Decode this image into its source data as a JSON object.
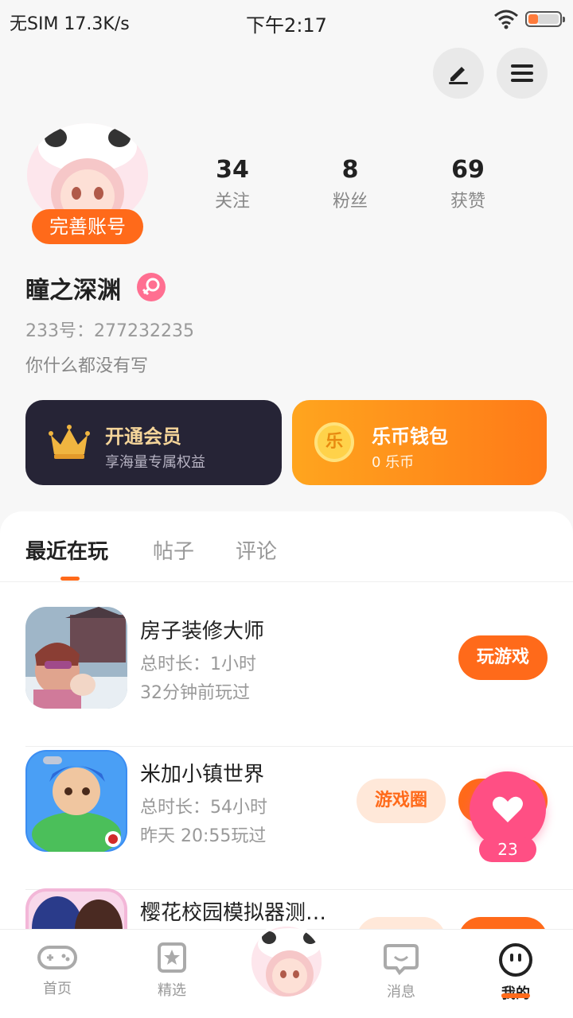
{
  "status_bar": {
    "carrier_speed": "无SIM 17.3K/s",
    "time": "下午2:17"
  },
  "profile": {
    "complete_label": "完善账号",
    "stats": [
      {
        "value": "34",
        "label": "关注"
      },
      {
        "value": "8",
        "label": "粉丝"
      },
      {
        "value": "69",
        "label": "获赞"
      }
    ],
    "username": "瞳之深渊",
    "uid": "233号：277232235",
    "bio": "你什么都没有写"
  },
  "cards": {
    "vip": {
      "title": "开通会员",
      "subtitle": "享海量专属权益"
    },
    "wallet": {
      "title": "乐币钱包",
      "subtitle": "0 乐币",
      "coin_char": "乐"
    }
  },
  "tabs": [
    {
      "label": "最近在玩"
    },
    {
      "label": "帖子"
    },
    {
      "label": "评论"
    }
  ],
  "games": [
    {
      "name": "房子装修大师",
      "duration": "总时长：1小时",
      "last_played": "32分钟前玩过",
      "play_label": "玩游戏"
    },
    {
      "name": "米加小镇世界",
      "duration": "总时长：54小时",
      "last_played": "昨天 20:55玩过",
      "circle_label": "游戏圈",
      "play_label": "玩游戏"
    },
    {
      "name": "樱花校园模拟器测…",
      "duration": "",
      "last_played": ""
    }
  ],
  "like_float": {
    "count": "23"
  },
  "bottom_nav": [
    {
      "label": "首页"
    },
    {
      "label": "精选"
    },
    {
      "label": "消息"
    },
    {
      "label": "我的"
    }
  ],
  "colors": {
    "accent": "#ff6a1a",
    "pink": "#ff4f84",
    "vip_bg": "#262436"
  }
}
